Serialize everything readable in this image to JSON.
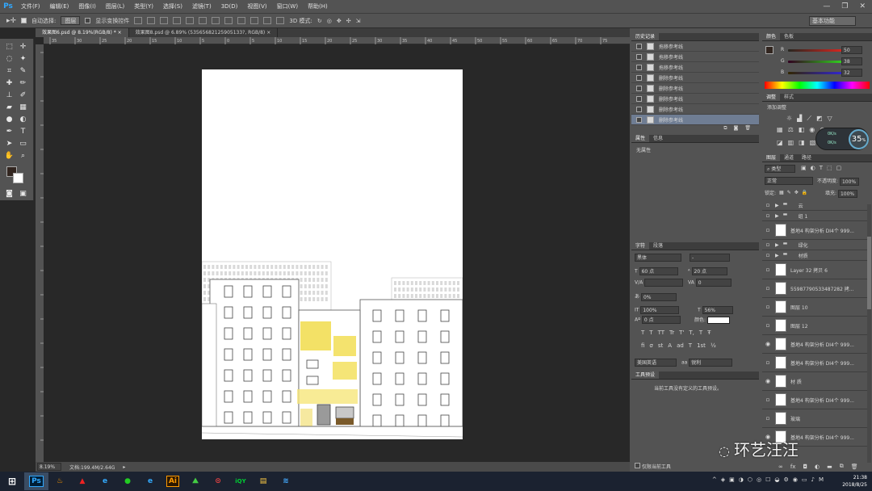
{
  "app": {
    "logo": "Ps"
  },
  "menu": [
    "文件(F)",
    "编辑(E)",
    "图像(I)",
    "图层(L)",
    "类型(Y)",
    "选择(S)",
    "滤镜(T)",
    "3D(D)",
    "视图(V)",
    "窗口(W)",
    "帮助(H)"
  ],
  "window_controls": {
    "minimize": "—",
    "restore": "❐",
    "close": "✕"
  },
  "options": {
    "auto_select_label": "自动选择:",
    "auto_select_value": "图层",
    "show_transform_label": "显示变换控件",
    "mode_3d_label": "3D 模式:",
    "workspace": "基本功能"
  },
  "tabs": [
    {
      "label": "效果图6.psd @ 8.19%(RGB/8) *",
      "close": "×"
    },
    {
      "label": "效果图8.psd @ 6.89% (53565682125905133?, RGB/8)",
      "close": "×"
    }
  ],
  "ruler_ticks": [
    "35",
    "30",
    "25",
    "20",
    "15",
    "10",
    "5",
    "0",
    "5",
    "10",
    "15",
    "20",
    "25",
    "30",
    "35",
    "40",
    "45",
    "50",
    "55",
    "60",
    "65",
    "70",
    "75"
  ],
  "status": {
    "zoom": "8.19%",
    "doc": "文档:199.4M/2.64G"
  },
  "history": {
    "tabs": [
      "历史记录"
    ],
    "items": [
      "拖移参考线",
      "拖移参考线",
      "拖移参考线",
      "删除参考线",
      "删除参考线",
      "删除参考线",
      "删除参考线",
      "删除参考线"
    ]
  },
  "properties": {
    "tabs": [
      "属性",
      "信息"
    ],
    "text": "无属性"
  },
  "character": {
    "tabs": [
      "字符",
      "段落"
    ],
    "font": "黑体",
    "style": "-",
    "size": "60 点",
    "leading": "20 点",
    "kerning": "",
    "tracking": "0",
    "baseline_pct": "0%",
    "vscale": "100%",
    "hscale": "56%",
    "baseline_shift": "0 点",
    "color_label": "颜色:",
    "styles": [
      "T",
      "T",
      "TT",
      "Tr",
      "T'",
      "T,",
      "T",
      "Ŧ"
    ],
    "language": "美国英语",
    "aa_prefix": "aa",
    "aa": "锐利"
  },
  "tool_presets": {
    "tabs": [
      "工具预设"
    ],
    "text": "当前工具没有定义的工具预设。",
    "footer": "仅限当前工具"
  },
  "color": {
    "tabs": [
      "颜色",
      "色板"
    ],
    "r_label": "R",
    "g_label": "G",
    "b_label": "B",
    "r": 50,
    "g": 38,
    "b": 32,
    "fg": "#322620"
  },
  "adjustments": {
    "tabs": [
      "调整",
      "样式"
    ],
    "label": "添加调整",
    "percent": "35",
    "percent_unit": "%",
    "net_up": "0K/s",
    "net_down": "0K/s"
  },
  "layers": {
    "tabs": [
      "图层",
      "通道",
      "路径"
    ],
    "filter": "类型",
    "blend": "正常",
    "opacity_label": "不透明度:",
    "opacity": "100%",
    "lock_label": "锁定:",
    "fill_label": "填充:",
    "fill": "100%",
    "items": [
      {
        "name": "云",
        "type": "folder",
        "visible": false
      },
      {
        "name": "组 1",
        "type": "folder",
        "visible": false
      },
      {
        "name": "基地4 构架分析 DI4个 999...",
        "type": "layer",
        "visible": false
      },
      {
        "name": "绿化",
        "type": "folder",
        "visible": false
      },
      {
        "name": "材质",
        "type": "folder",
        "visible": false
      },
      {
        "name": "Layer 32 拷贝 6",
        "type": "layer",
        "visible": false
      },
      {
        "name": "55987790533487282 拷...",
        "type": "layer",
        "visible": false
      },
      {
        "name": "图层 10",
        "type": "layer",
        "visible": false
      },
      {
        "name": "图层 12",
        "type": "layer",
        "visible": false
      },
      {
        "name": "基地4 构架分析 DI4个 999...",
        "type": "layer",
        "visible": true
      },
      {
        "name": "基地4 构架分析 DI4个 999...",
        "type": "layer",
        "visible": false
      },
      {
        "name": "材 质",
        "type": "layer",
        "visible": true
      },
      {
        "name": "基地4 构架分析 DI4个 999...",
        "type": "layer",
        "visible": false
      },
      {
        "name": "玻璃",
        "type": "layer",
        "visible": false
      },
      {
        "name": "基地4 构架分析 DI4个 999...",
        "type": "layer",
        "visible": true
      }
    ]
  },
  "taskbar": {
    "apps": [
      "Ps",
      "♨",
      "▲",
      "e",
      "●",
      "e",
      "Ai",
      "⛰",
      "⊙",
      "iQY",
      "▤",
      "≋"
    ],
    "time": "21:38",
    "date": "2018/8/25",
    "ime": "M"
  },
  "watermark": "环艺汪汪",
  "colors": {
    "accent": "#31a8ff",
    "history_selected": "#6f7d93",
    "panel": "#535353",
    "canvas": "#282828"
  }
}
